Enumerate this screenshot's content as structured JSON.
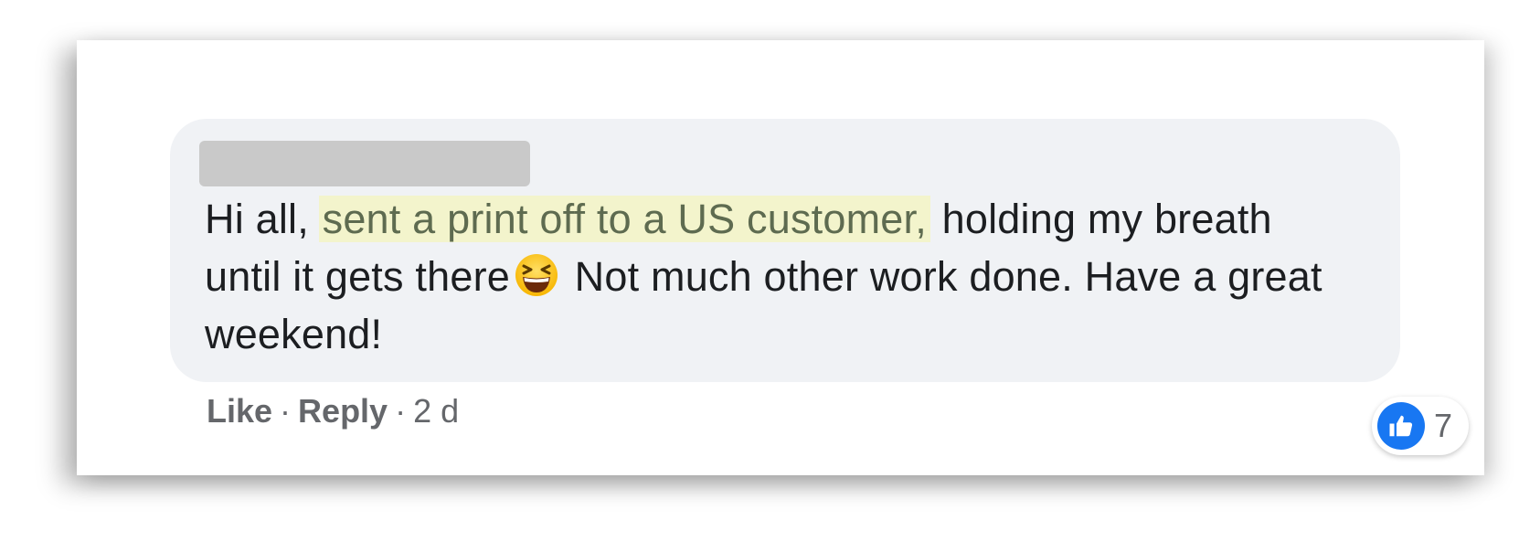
{
  "comment": {
    "text_before": "Hi all, ",
    "highlighted": "sent a print off to a US customer,",
    "text_after_highlight": " holding my breath until it gets there",
    "emoji": "laughing-squinting-face-emoji",
    "text_end": " Not much other work done. Have a great weekend!"
  },
  "actions": {
    "like_label": "Like",
    "separator": "·",
    "reply_label": "Reply",
    "timestamp": "2 d"
  },
  "reactions": {
    "icon": "like-thumbs-up-icon",
    "count": "7"
  },
  "colors": {
    "bubble": "#f0f2f5",
    "highlight": "#f3f4cc",
    "like_blue": "#1877f2",
    "meta_text": "#65676b"
  }
}
